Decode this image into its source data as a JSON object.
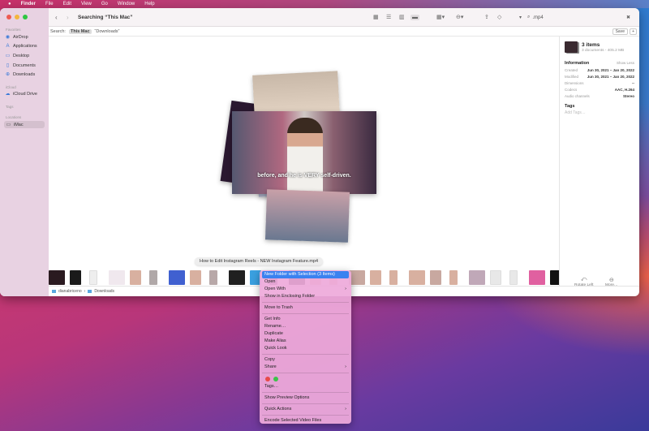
{
  "menubar": {
    "apple": "",
    "items": [
      "Finder",
      "File",
      "Edit",
      "View",
      "Go",
      "Window",
      "Help"
    ]
  },
  "window": {
    "title": "Searching “This Mac”"
  },
  "sidebar": {
    "favorites_label": "Favorites",
    "favorites": [
      {
        "label": "AirDrop",
        "icon": "airdrop-icon"
      },
      {
        "label": "Applications",
        "icon": "applications-icon"
      },
      {
        "label": "Desktop",
        "icon": "desktop-icon"
      },
      {
        "label": "Documents",
        "icon": "documents-icon"
      },
      {
        "label": "Downloads",
        "icon": "downloads-icon"
      }
    ],
    "icloud_label": "iCloud",
    "icloud": [
      {
        "label": "iCloud Drive",
        "icon": "cloud-icon"
      }
    ],
    "tags_label": "Tags",
    "locations_label": "Locations",
    "locations": [
      {
        "label": "iMac",
        "icon": "imac-icon",
        "selected": true
      }
    ]
  },
  "search": {
    "value": ".mp4",
    "scope_label": "Search:",
    "scope_this_mac": "This Mac",
    "scope_downloads": "“Downloads”",
    "save": "Save",
    "plus": "+"
  },
  "preview": {
    "caption": "before, and he is VERY self-driven.",
    "tooltip": "How to Edit Instagram Reels - NEW Instagram Feature.mp4"
  },
  "panel": {
    "title": "3 items",
    "subtitle": "3 documents - 405.2 MB",
    "info_label": "Information",
    "show_less": "Show Less",
    "rows": [
      {
        "k": "Created",
        "v": "Jun 30, 2021 – Jan 20, 2022"
      },
      {
        "k": "Modified",
        "v": "Jun 30, 2021 – Jan 20, 2022"
      },
      {
        "k": "Dimensions",
        "v": "--"
      },
      {
        "k": "Codecs",
        "v": "AAC, H.264"
      },
      {
        "k": "Audio channels",
        "v": "Stereo"
      }
    ],
    "tags_label": "Tags",
    "add_tags": "Add Tags…",
    "rotate_left": "Rotate Left",
    "more": "More…"
  },
  "pathbar": {
    "items": [
      "dianabriceno",
      "Downloads"
    ]
  },
  "context_menu": {
    "items": [
      "New Folder with Selection (3 Items)",
      "Open",
      "Open With",
      "Show in Enclosing Folder",
      "Move to Trash",
      "Get Info",
      "Rename…",
      "Duplicate",
      "Make Alias",
      "Quick Look",
      "Copy",
      "Share",
      "Tags…",
      "Show Preview Options",
      "Quick Actions",
      "Encode Selected Video Files"
    ],
    "tag_colors": [
      "#e84a4a",
      "#3cc24a"
    ]
  },
  "colors": {
    "accent": "#3b82f0"
  }
}
